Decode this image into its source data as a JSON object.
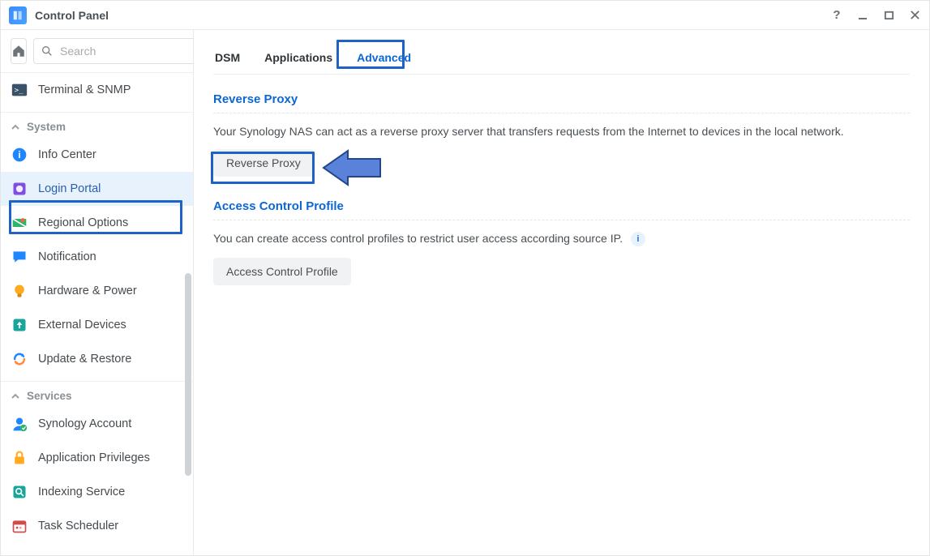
{
  "window": {
    "title": "Control Panel"
  },
  "sidebar": {
    "search_placeholder": "Search",
    "top_items": [
      {
        "label": "Terminal & SNMP"
      }
    ],
    "groups": [
      {
        "name": "System",
        "items": [
          {
            "label": "Info Center"
          },
          {
            "label": "Login Portal",
            "selected": true
          },
          {
            "label": "Regional Options"
          },
          {
            "label": "Notification"
          },
          {
            "label": "Hardware & Power"
          },
          {
            "label": "External Devices"
          },
          {
            "label": "Update & Restore"
          }
        ]
      },
      {
        "name": "Services",
        "items": [
          {
            "label": "Synology Account"
          },
          {
            "label": "Application Privileges"
          },
          {
            "label": "Indexing Service"
          },
          {
            "label": "Task Scheduler"
          }
        ]
      }
    ]
  },
  "main": {
    "tabs": {
      "dsm": "DSM",
      "applications": "Applications",
      "advanced": "Advanced"
    },
    "reverse_proxy": {
      "title": "Reverse Proxy",
      "desc": "Your Synology NAS can act as a reverse proxy server that transfers requests from the Internet to devices in the local network.",
      "button": "Reverse Proxy"
    },
    "acp": {
      "title": "Access Control Profile",
      "desc": "You can create access control profiles to restrict user access according source IP.",
      "button": "Access Control Profile"
    }
  }
}
